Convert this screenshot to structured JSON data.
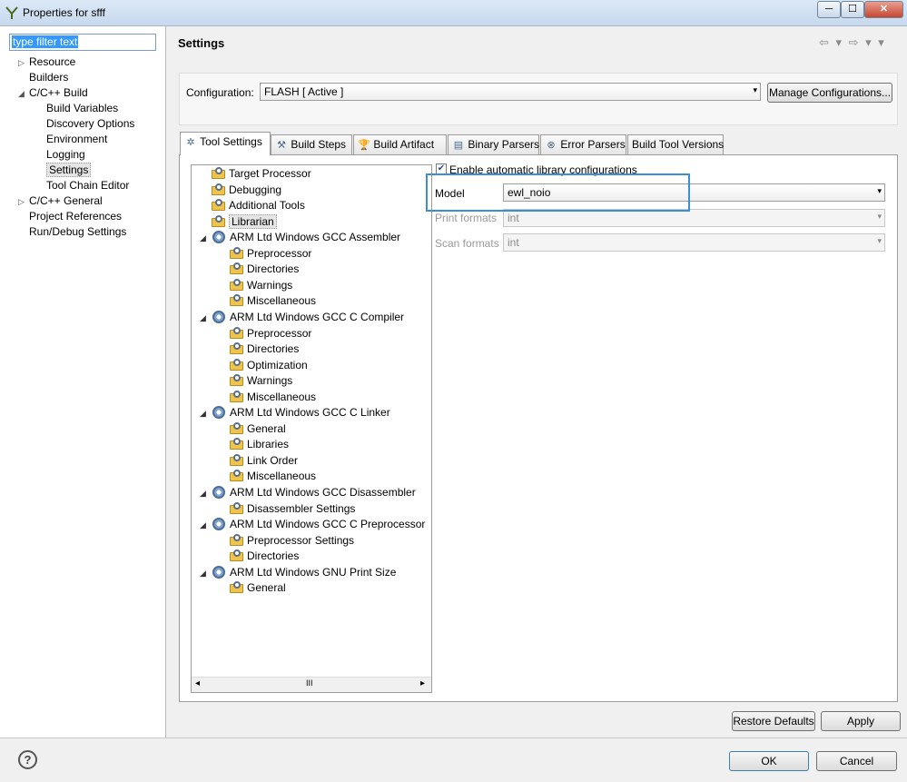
{
  "window": {
    "title": "Properties for sfff",
    "minimize": "─",
    "maximize": "☐",
    "close": "✕"
  },
  "filter": {
    "value": "type filter text"
  },
  "nav": [
    {
      "label": "Resource",
      "expander": "▷"
    },
    {
      "label": "Builders",
      "expander": ""
    },
    {
      "label": "C/C++ Build",
      "expander": "◢"
    },
    {
      "label": "Build Variables",
      "expander": ""
    },
    {
      "label": "Discovery Options",
      "expander": ""
    },
    {
      "label": "Environment",
      "expander": ""
    },
    {
      "label": "Logging",
      "expander": ""
    },
    {
      "label": "Settings",
      "expander": ""
    },
    {
      "label": "Tool Chain Editor",
      "expander": ""
    },
    {
      "label": "C/C++ General",
      "expander": "▷"
    },
    {
      "label": "Project References",
      "expander": ""
    },
    {
      "label": "Run/Debug Settings",
      "expander": ""
    }
  ],
  "page": {
    "title": "Settings",
    "nav_arrows": "⇦ ▾ ⇨ ▾ ▾"
  },
  "config": {
    "label": "Configuration:",
    "value": "FLASH  [ Active ]",
    "manage": "Manage Configurations..."
  },
  "tabs": [
    {
      "label": "Tool Settings",
      "icon": "✲"
    },
    {
      "label": "Build Steps",
      "icon": "⚒"
    },
    {
      "label": "Build Artifact",
      "icon": "🏆"
    },
    {
      "label": "Binary Parsers",
      "icon": "▤"
    },
    {
      "label": "Error Parsers",
      "icon": "⊗"
    },
    {
      "label": "Build Tool Versions",
      "icon": ""
    }
  ],
  "tree": [
    {
      "label": "Target Processor",
      "kind": "folder"
    },
    {
      "label": "Debugging",
      "kind": "folder"
    },
    {
      "label": "Additional Tools",
      "kind": "folder"
    },
    {
      "label": "Librarian",
      "kind": "folder"
    },
    {
      "label": "ARM Ltd Windows GCC Assembler",
      "kind": "tool"
    },
    {
      "label": "Preprocessor",
      "kind": "child"
    },
    {
      "label": "Directories",
      "kind": "child"
    },
    {
      "label": "Warnings",
      "kind": "child"
    },
    {
      "label": "Miscellaneous",
      "kind": "child"
    },
    {
      "label": "ARM Ltd Windows GCC C Compiler",
      "kind": "tool"
    },
    {
      "label": "Preprocessor",
      "kind": "child"
    },
    {
      "label": "Directories",
      "kind": "child"
    },
    {
      "label": "Optimization",
      "kind": "child"
    },
    {
      "label": "Warnings",
      "kind": "child"
    },
    {
      "label": "Miscellaneous",
      "kind": "child"
    },
    {
      "label": "ARM Ltd Windows GCC C Linker",
      "kind": "tool"
    },
    {
      "label": "General",
      "kind": "child"
    },
    {
      "label": "Libraries",
      "kind": "child"
    },
    {
      "label": "Link Order",
      "kind": "child"
    },
    {
      "label": "Miscellaneous",
      "kind": "child"
    },
    {
      "label": "ARM Ltd Windows GCC Disassembler",
      "kind": "tool"
    },
    {
      "label": "Disassembler Settings",
      "kind": "child"
    },
    {
      "label": "ARM Ltd Windows GCC C Preprocessor",
      "kind": "tool"
    },
    {
      "label": "Preprocessor Settings",
      "kind": "child"
    },
    {
      "label": "Directories",
      "kind": "child"
    },
    {
      "label": "ARM Ltd Windows GNU Print Size",
      "kind": "tool"
    },
    {
      "label": "General",
      "kind": "child"
    }
  ],
  "scroll": {
    "grip": "III",
    "left": "◂",
    "right": "▸"
  },
  "options": {
    "auto_lib": "Enable automatic library configurations",
    "checkmark": "✔",
    "model_label": "Model",
    "model_value": "ewl_noio",
    "print_label": "Print formats",
    "print_value": "int",
    "scan_label": "Scan formats",
    "scan_value": "int",
    "arrow": "▾"
  },
  "buttons": {
    "restore": "Restore Defaults",
    "apply": "Apply",
    "ok": "OK",
    "cancel": "Cancel",
    "help": "?"
  }
}
